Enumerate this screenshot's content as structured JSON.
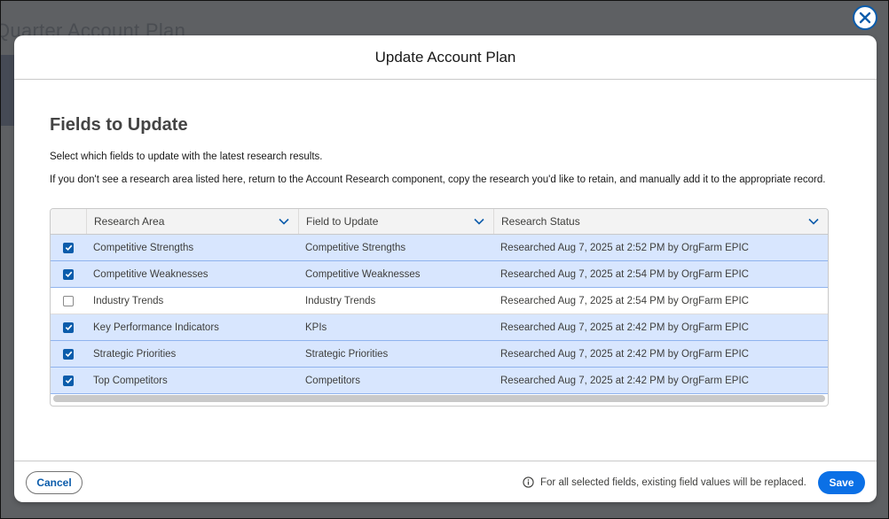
{
  "modal": {
    "title": "Update Account Plan",
    "section_title": "Fields to Update",
    "description": "Select which fields to update with the latest research results.",
    "help_text": "If you don't see a research area listed here, return to the Account Research component, copy the research you'd like to retain, and manually add it to the appropriate record."
  },
  "table": {
    "columns": [
      "Research Area",
      "Field to Update",
      "Research Status"
    ],
    "rows": [
      {
        "checked": true,
        "area": "Competitive Strengths",
        "field": "Competitive Strengths",
        "status": "Researched Aug 7, 2025 at 2:52 PM by OrgFarm EPIC"
      },
      {
        "checked": true,
        "area": "Competitive Weaknesses",
        "field": "Competitive Weaknesses",
        "status": "Researched Aug 7, 2025 at 2:54 PM by OrgFarm EPIC"
      },
      {
        "checked": false,
        "area": "Industry Trends",
        "field": "Industry Trends",
        "status": "Researched Aug 7, 2025 at 2:54 PM by OrgFarm EPIC"
      },
      {
        "checked": true,
        "area": "Key Performance Indicators",
        "field": "KPIs",
        "status": "Researched Aug 7, 2025 at 2:42 PM by OrgFarm EPIC"
      },
      {
        "checked": true,
        "area": "Strategic Priorities",
        "field": "Strategic Priorities",
        "status": "Researched Aug 7, 2025 at 2:42 PM by OrgFarm EPIC"
      },
      {
        "checked": true,
        "area": "Top Competitors",
        "field": "Competitors",
        "status": "Researched Aug 7, 2025 at 2:42 PM by OrgFarm EPIC"
      }
    ]
  },
  "footer": {
    "cancel_label": "Cancel",
    "note": "For all selected fields, existing field values will be replaced.",
    "save_label": "Save"
  },
  "background": {
    "ghost_title": "Quarter Account Plan"
  },
  "colors": {
    "brand": "#0b5cab",
    "selected_row": "#d8e6fe",
    "save_button": "#0b70e6"
  },
  "icons": {
    "close": "close-icon",
    "checkbox_checked": "checkmark-icon",
    "column_menu": "chevron-down-icon",
    "info": "info-icon"
  }
}
